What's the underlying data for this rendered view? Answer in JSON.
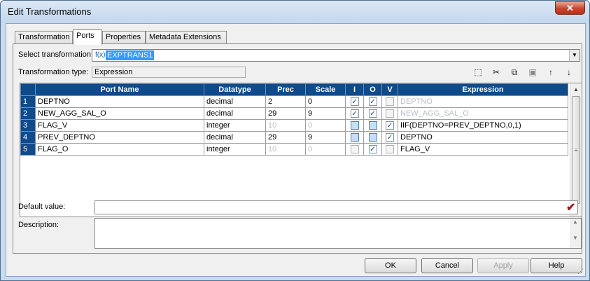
{
  "window": {
    "title": "Edit Transformations",
    "close_label": "✕"
  },
  "tabs": [
    {
      "label": "Transformation"
    },
    {
      "label": "Ports",
      "active": true
    },
    {
      "label": "Properties"
    },
    {
      "label": "Metadata Extensions"
    }
  ],
  "select_transformation": {
    "label": "Select transformation:",
    "icon": "f(x)",
    "value": "EXPTRANS1"
  },
  "transformation_type": {
    "label": "Transformation type:",
    "value": "Expression"
  },
  "toolbar_icons": [
    "new-port-icon",
    "cut-icon",
    "copy-icon",
    "paste-icon",
    "move-up-icon",
    "move-down-icon"
  ],
  "grid": {
    "columns": [
      "Port Name",
      "Datatype",
      "Prec",
      "Scale",
      "I",
      "O",
      "V",
      "Expression"
    ],
    "rows": [
      {
        "num": "1",
        "name": "DEPTNO",
        "datatype": "decimal",
        "prec": "2",
        "scale": "0",
        "i": true,
        "o": true,
        "v": false,
        "expression": "DEPTNO",
        "expr_dim": true,
        "prec_dim": false
      },
      {
        "num": "2",
        "name": "NEW_AGG_SAL_O",
        "datatype": "decimal",
        "prec": "29",
        "scale": "9",
        "i": true,
        "o": true,
        "v": false,
        "expression": "NEW_AGG_SAL_O",
        "expr_dim": true,
        "prec_dim": false
      },
      {
        "num": "3",
        "name": "FLAG_V",
        "datatype": "integer",
        "prec": "10",
        "scale": "0",
        "i": false,
        "o": false,
        "v": true,
        "expression": "IIF(DEPTNO=PREV_DEPTNO,0,1)",
        "expr_dim": false,
        "prec_dim": true
      },
      {
        "num": "4",
        "name": "PREV_DEPTNO",
        "datatype": "decimal",
        "prec": "29",
        "scale": "9",
        "i": false,
        "o": false,
        "v": true,
        "expression": "DEPTNO",
        "expr_dim": false,
        "prec_dim": false
      },
      {
        "num": "5",
        "name": "FLAG_O",
        "datatype": "integer",
        "prec": "10",
        "scale": "0",
        "i": false,
        "o": true,
        "v": false,
        "expression": "FLAG_V",
        "expr_dim": false,
        "prec_dim": true
      }
    ]
  },
  "default_value": {
    "label": "Default value:",
    "value": ""
  },
  "description": {
    "label": "Description:",
    "value": ""
  },
  "buttons": {
    "ok": "OK",
    "cancel": "Cancel",
    "apply": "Apply",
    "help": "Help"
  }
}
